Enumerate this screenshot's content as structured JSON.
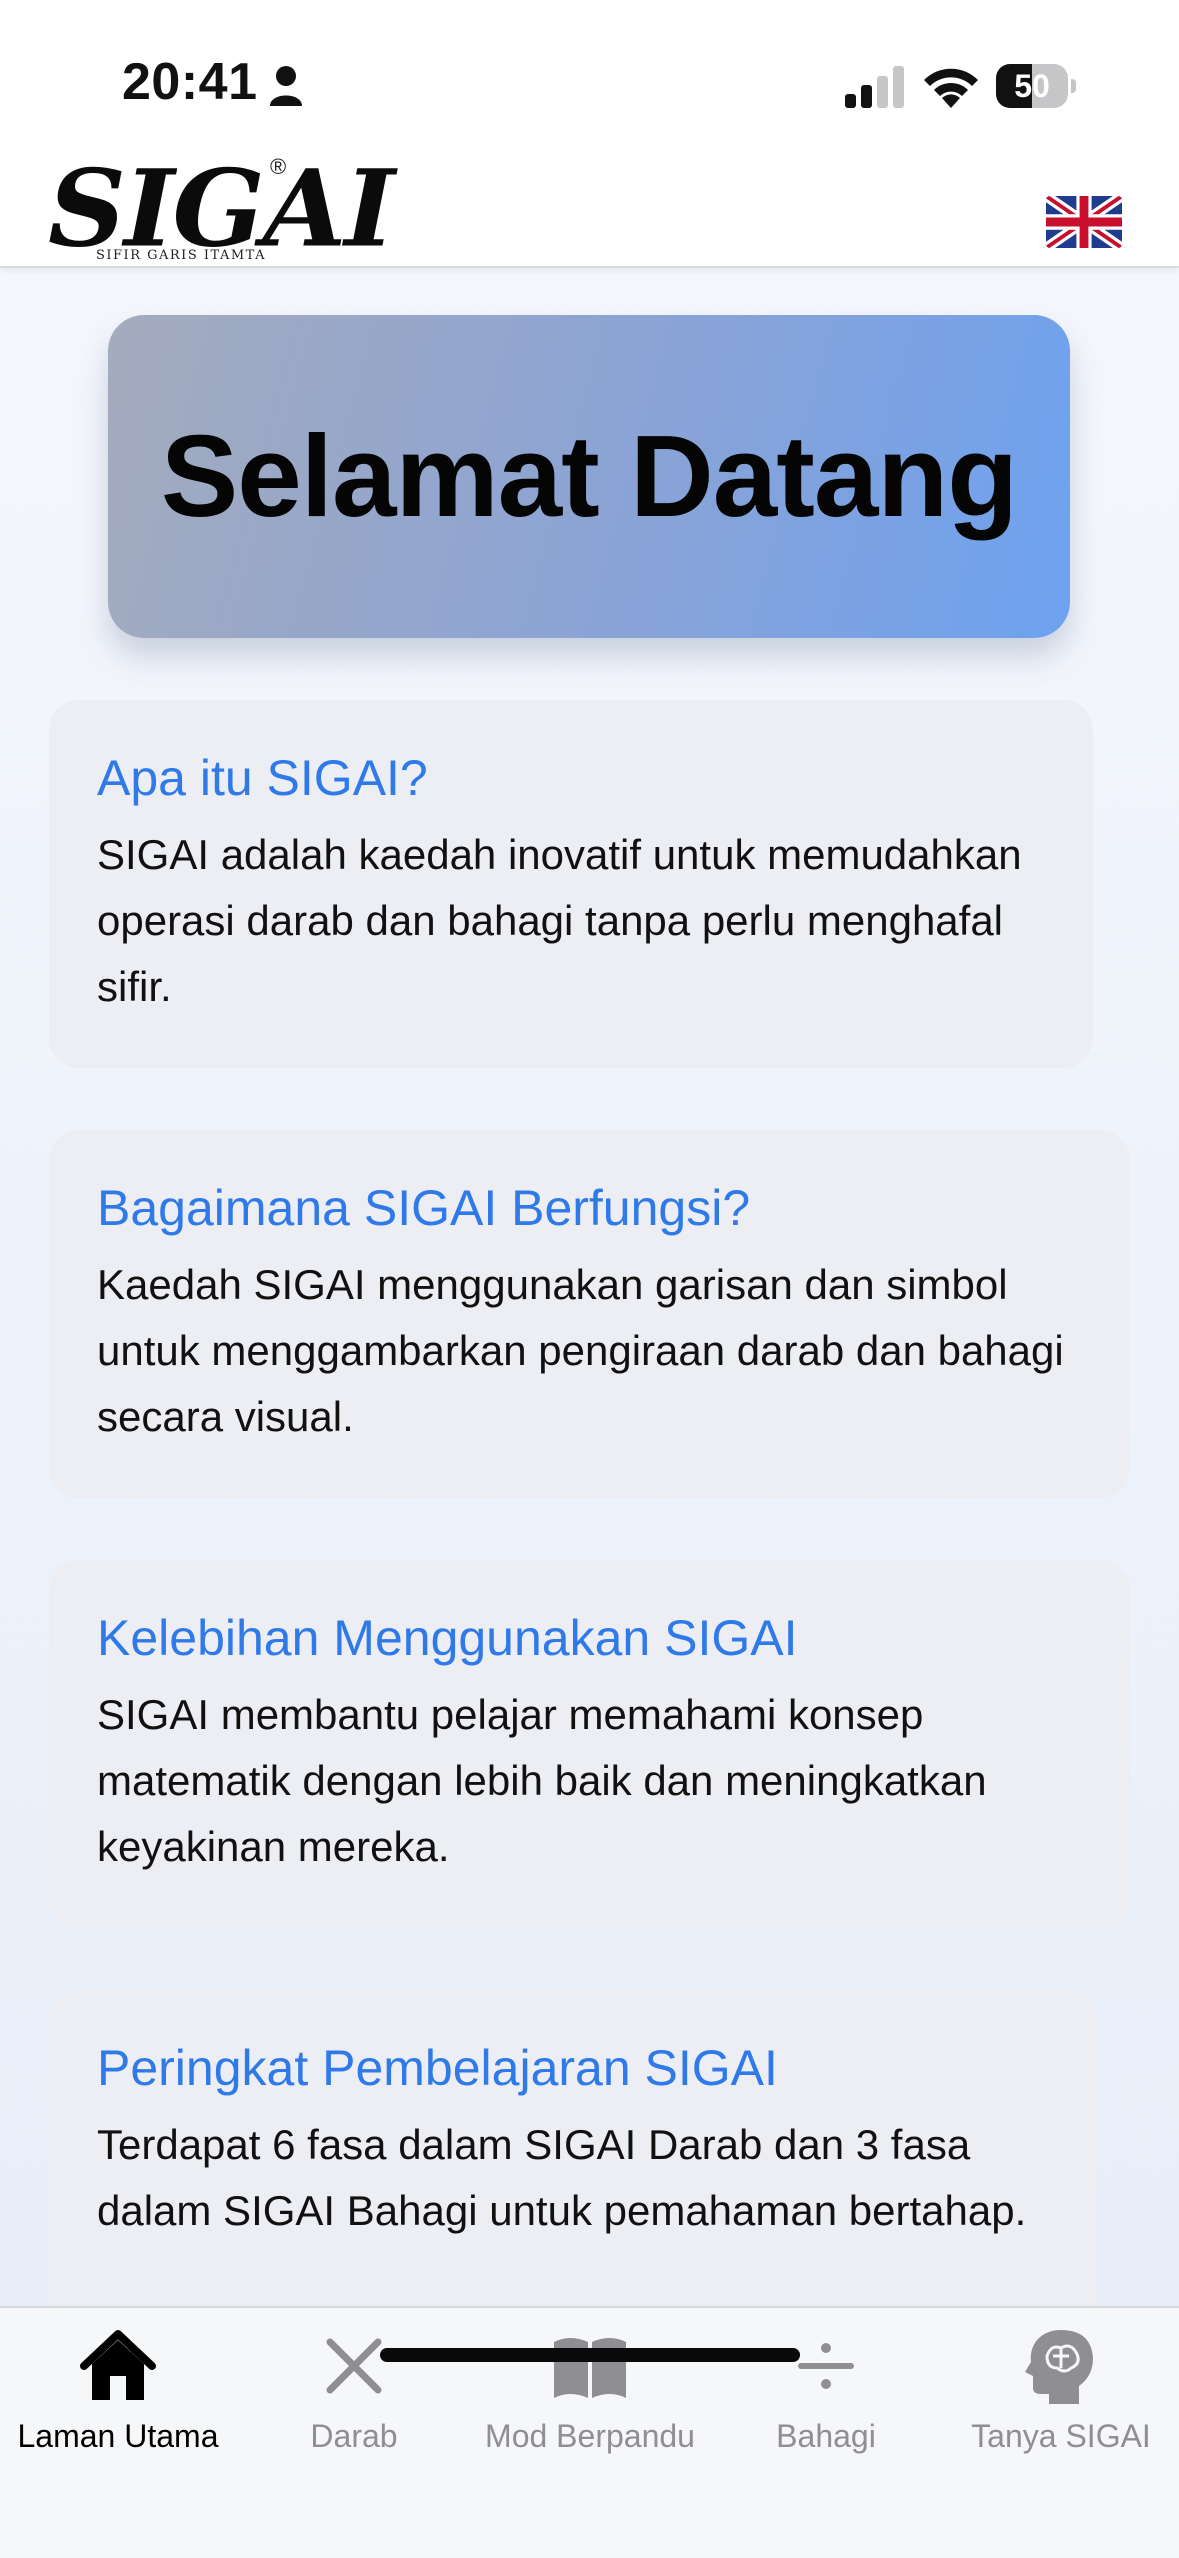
{
  "status_bar": {
    "time": "20:41",
    "battery_level": "50",
    "battery_fraction": 0.5
  },
  "header": {
    "logo_text": "SIGAI",
    "logo_registered": "®",
    "logo_subtitle": "SIFIR GARIS ITAMTA",
    "language_flag": "uk-flag-icon"
  },
  "welcome": {
    "title": "Selamat Datang"
  },
  "cards": [
    {
      "title": "Apa itu SIGAI?",
      "body": "SIGAI adalah kaedah inovatif untuk memudahkan operasi darab dan bahagi tanpa perlu menghafal sifir."
    },
    {
      "title": "Bagaimana SIGAI Berfungsi?",
      "body": "Kaedah SIGAI menggunakan garisan dan simbol untuk menggambarkan pengiraan darab dan bahagi secara visual."
    },
    {
      "title": "Kelebihan Menggunakan SIGAI",
      "body": "SIGAI membantu pelajar memahami konsep matematik dengan lebih baik dan meningkatkan keyakinan mereka."
    },
    {
      "title": "Peringkat Pembelajaran SIGAI",
      "body": "Terdapat 6 fasa dalam SIGAI Darab dan 3 fasa dalam SIGAI Bahagi untuk pemahaman bertahap."
    }
  ],
  "tabs": [
    {
      "label": "Laman Utama",
      "icon": "house-icon",
      "active": true
    },
    {
      "label": "Darab",
      "icon": "multiply-icon",
      "active": false
    },
    {
      "label": "Mod Berpandu",
      "icon": "book-icon",
      "active": false
    },
    {
      "label": "Bahagi",
      "icon": "divide-icon",
      "active": false
    },
    {
      "label": "Tanya SIGAI",
      "icon": "brain-head-icon",
      "active": false
    }
  ],
  "colors": {
    "accent": "#2f7ae8",
    "card_bg": "#eceef3",
    "inactive_tab": "#8e8e93"
  }
}
